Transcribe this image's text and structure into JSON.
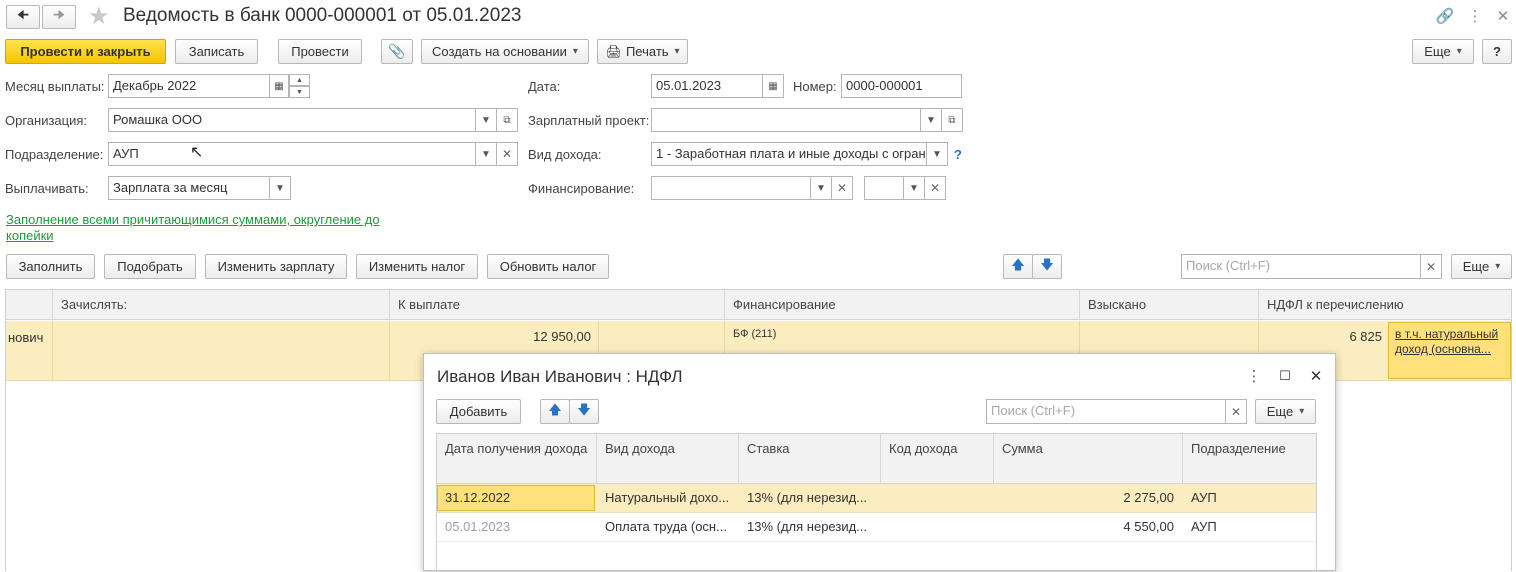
{
  "title": "Ведомость в банк 0000-000001 от 05.01.2023",
  "toolbar": {
    "post_close": "Провести и закрыть",
    "save": "Записать",
    "post": "Провести",
    "create_based": "Создать на основании",
    "print": "Печать",
    "more": "Еще",
    "help": "?"
  },
  "form": {
    "month_label": "Месяц выплаты:",
    "month_value": "Декабрь 2022",
    "org_label": "Организация:",
    "org_value": "Ромашка ООО",
    "dept_label": "Подразделение:",
    "dept_value": "АУП",
    "pay_label": "Выплачивать:",
    "pay_value": "Зарплата за месяц",
    "date_label": "Дата:",
    "date_value": "05.01.2023",
    "number_label": "Номер:",
    "number_value": "0000-000001",
    "salary_project_label": "Зарплатный проект:",
    "salary_project_value": "",
    "income_type_label": "Вид дохода:",
    "income_type_value": "1 - Заработная плата и иные доходы с огран",
    "financing_label": "Финансирование:",
    "fill_link": "Заполнение всеми причитающимися суммами, округление до копейки"
  },
  "table_toolbar": {
    "fill": "Заполнить",
    "pick": "Подобрать",
    "change_salary": "Изменить зарплату",
    "change_tax": "Изменить налог",
    "update_tax": "Обновить налог",
    "search_placeholder": "Поиск (Ctrl+F)",
    "more": "Еще"
  },
  "table": {
    "columns": [
      "Зачислять:",
      "К выплате",
      "Финансирование",
      "Взыскано",
      "НДФЛ к перечислению"
    ],
    "row": {
      "name_fragment": "нович",
      "to_pay": "12 950,00",
      "financing": "БФ (211)",
      "ndfl": "6 825",
      "ndfl_link": "в т.ч. натуральный доход (основна..."
    }
  },
  "dialog": {
    "title": "Иванов Иван Иванович : НДФЛ",
    "add": "Добавить",
    "search_placeholder": "Поиск (Ctrl+F)",
    "more": "Еще",
    "columns": [
      "Дата получения дохода",
      "Вид дохода",
      "Ставка",
      "Код дохода",
      "Сумма",
      "Подразделение"
    ],
    "rows": [
      {
        "date": "31.12.2022",
        "type": "Натуральный дохо...",
        "rate": "13% (для нерезид...",
        "code": "",
        "sum": "2 275,00",
        "dept": "АУП"
      },
      {
        "date": "05.01.2023",
        "type": "Оплата труда (осн...",
        "rate": "13% (для нерезид...",
        "code": "",
        "sum": "4 550,00",
        "dept": "АУП"
      }
    ]
  }
}
